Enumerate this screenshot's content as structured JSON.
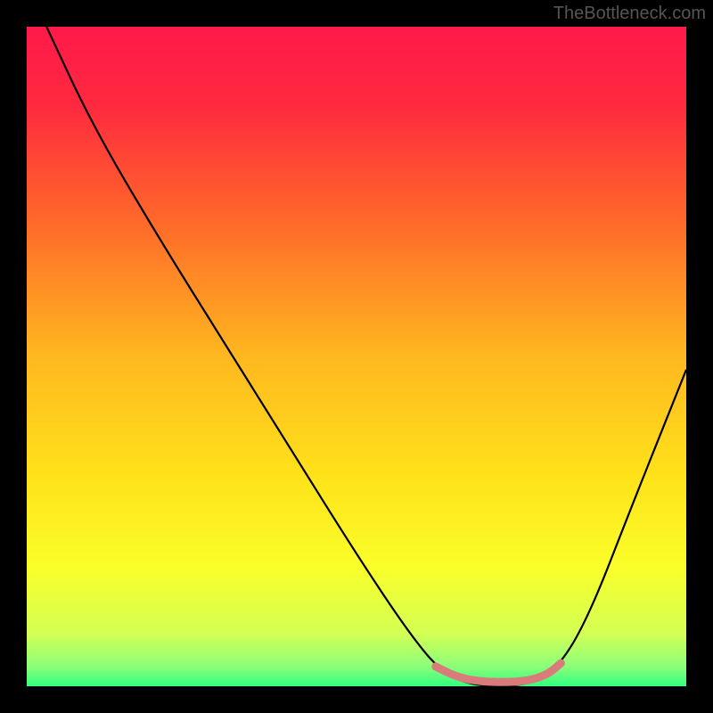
{
  "watermark": "TheBottleneck.com",
  "chart_data": {
    "type": "line",
    "title": "",
    "xlabel": "",
    "ylabel": "",
    "xlim": [
      0,
      100
    ],
    "ylim": [
      0,
      100
    ],
    "gradient_stops": [
      {
        "pct": 0,
        "color": "#ff1a4a"
      },
      {
        "pct": 12,
        "color": "#ff2a3f"
      },
      {
        "pct": 30,
        "color": "#ff6b2a"
      },
      {
        "pct": 50,
        "color": "#ffb820"
      },
      {
        "pct": 68,
        "color": "#ffe21a"
      },
      {
        "pct": 82,
        "color": "#faff2a"
      },
      {
        "pct": 92,
        "color": "#d4ff55"
      },
      {
        "pct": 97,
        "color": "#8cff7a"
      },
      {
        "pct": 100,
        "color": "#30ff80"
      }
    ],
    "series": [
      {
        "name": "bottleneck-curve",
        "points": [
          {
            "x": 3,
            "y": 100
          },
          {
            "x": 10,
            "y": 85
          },
          {
            "x": 20,
            "y": 68
          },
          {
            "x": 30,
            "y": 52
          },
          {
            "x": 40,
            "y": 36
          },
          {
            "x": 50,
            "y": 20
          },
          {
            "x": 58,
            "y": 8
          },
          {
            "x": 63,
            "y": 2
          },
          {
            "x": 68,
            "y": 0
          },
          {
            "x": 75,
            "y": 0
          },
          {
            "x": 80,
            "y": 2
          },
          {
            "x": 85,
            "y": 10
          },
          {
            "x": 92,
            "y": 28
          },
          {
            "x": 100,
            "y": 48
          }
        ]
      }
    ],
    "highlight_segment": {
      "color": "#d97b7b",
      "points": [
        {
          "x": 62,
          "y": 3
        },
        {
          "x": 65,
          "y": 1.5
        },
        {
          "x": 68,
          "y": 0.8
        },
        {
          "x": 72,
          "y": 0.6
        },
        {
          "x": 76,
          "y": 0.8
        },
        {
          "x": 79,
          "y": 1.8
        },
        {
          "x": 81,
          "y": 3.5
        }
      ]
    }
  }
}
